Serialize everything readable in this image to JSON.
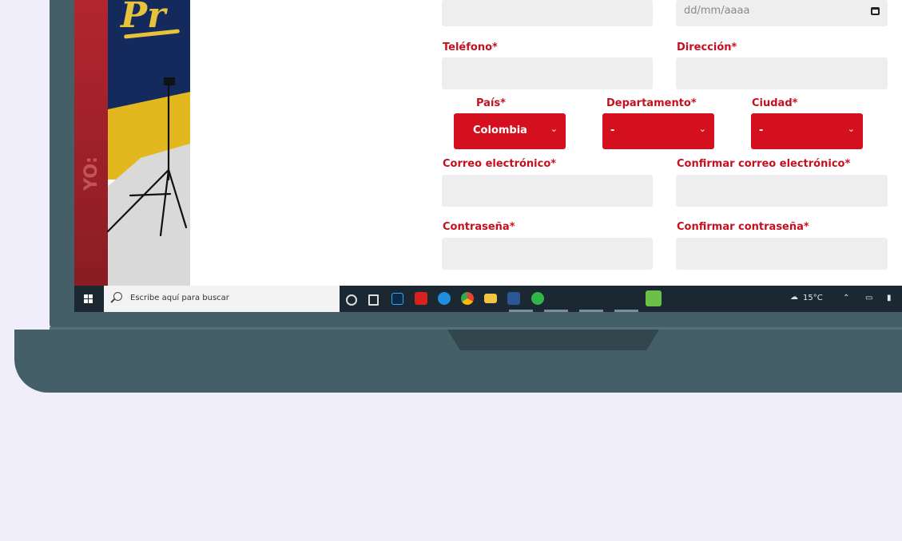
{
  "background_color": "#f1eefb",
  "laptop_color": "#455f68",
  "accent_color": "#d4101f",
  "banner": {
    "script_text": "Pr",
    "side_letters": "YO:"
  },
  "form": {
    "date_field": {
      "placeholder": "dd/mm/aaaa",
      "icon": "calendar-icon"
    },
    "telefono_label": "Teléfono*",
    "direccion_label": "Dirección*",
    "pais_label": "País*",
    "departamento_label": "Departamento*",
    "ciudad_label": "Ciudad*",
    "pais_value": "Colombia",
    "departamento_value": "-",
    "ciudad_value": "-",
    "correo_label": "Correo electrónico*",
    "confirmar_correo_label": "Confirmar correo electrónico*",
    "contrasena_label": "Contraseña*",
    "confirmar_contrasena_label": "Confirmar contraseña*"
  },
  "taskbar": {
    "search_placeholder": "Escribe aquí para buscar",
    "apps": [
      "cortana-icon",
      "task-view-icon",
      "photoshop-icon",
      "acrobat-icon",
      "edge-icon",
      "chrome-icon",
      "file-explorer-icon",
      "word-icon",
      "whatsapp-icon",
      "green-app-icon"
    ],
    "weather": "15°C",
    "tray_icons": [
      "weather-icon",
      "chevron-up-icon",
      "network-icon",
      "battery-icon"
    ]
  }
}
